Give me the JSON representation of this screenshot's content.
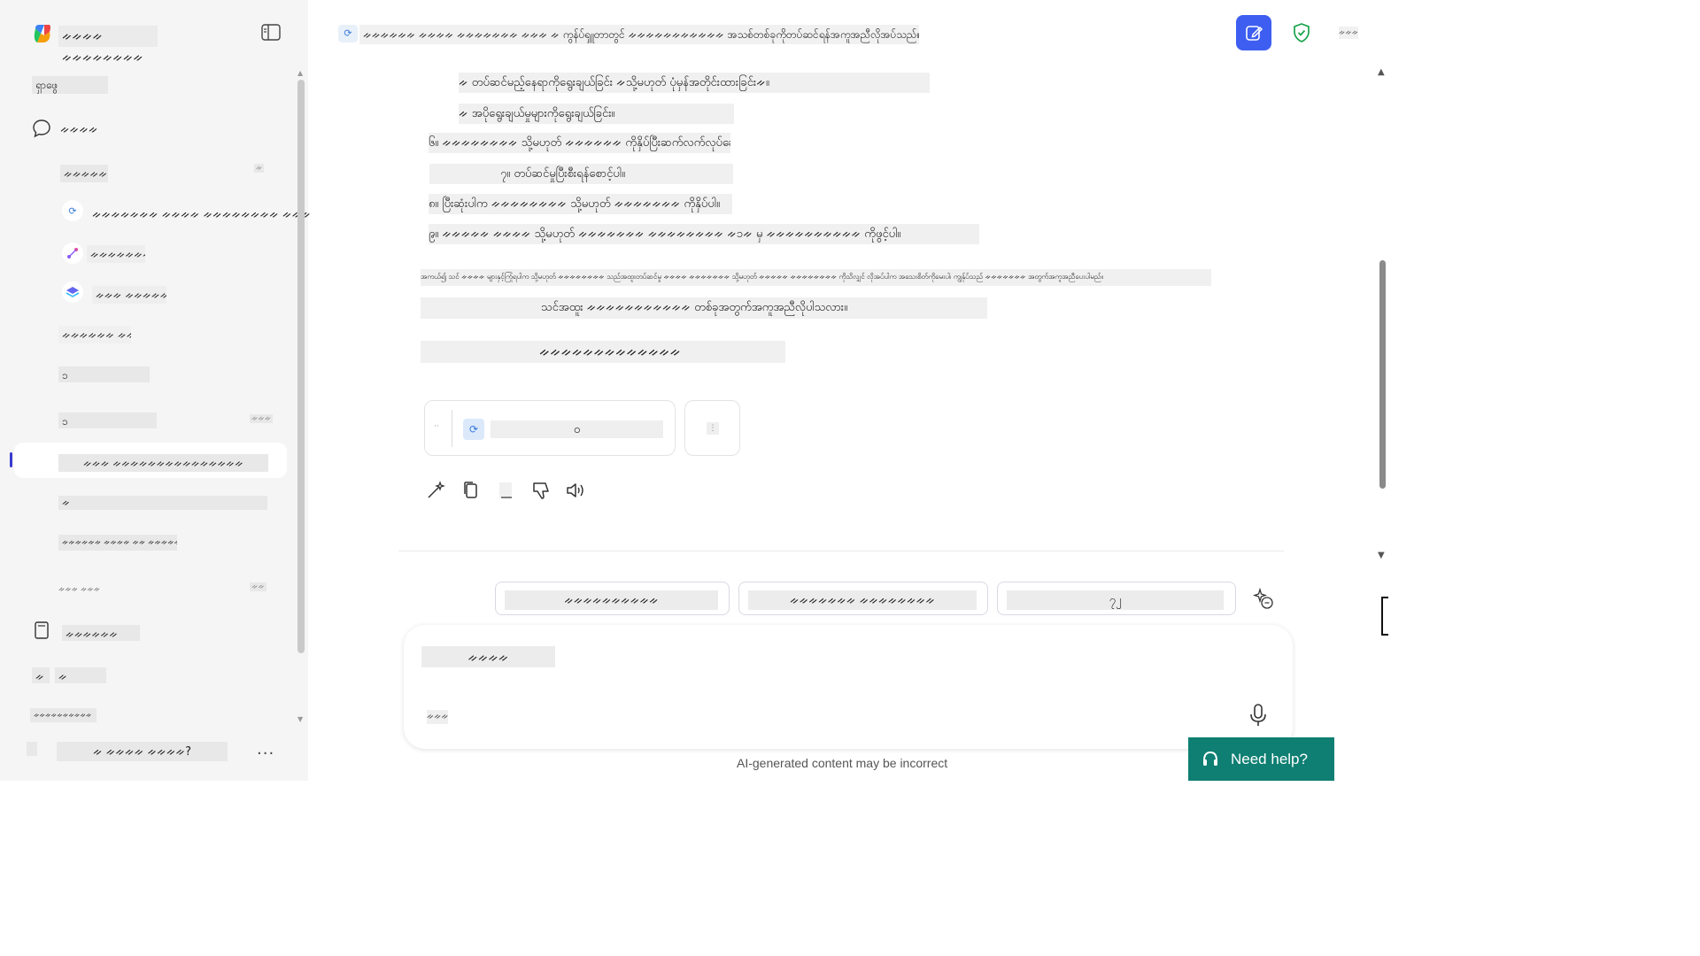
{
  "app": {
    "title": "ᨀᨀᨀᨀ ᨀᨀᨀᨀᨀᨀᨀᨀ"
  },
  "sidebar": {
    "discover": "ရှာဖွေ",
    "chats": "ᨀᨀᨀᨀ",
    "recent_header": "ᨀᨀᨀᨀᨀᨀ",
    "recent_badge": "ᨀ",
    "items": [
      {
        "label": "ᨀᨀᨀᨀᨀᨀᨀ ᨀᨀᨀᨀ ᨀᨀᨀᨀᨀᨀᨀᨀ ᨀᨀᨀ"
      },
      {
        "label": "ᨀᨀᨀᨀᨀᨀᨀ"
      },
      {
        "label": "ᨀᨀᨀ ᨀᨀᨀᨀᨀᨀ"
      }
    ],
    "section2": "ᨀᨀᨀᨀᨀᨀ ᨀᨀᨀᨀᨀ",
    "item_a": "၁",
    "item_b": "၁",
    "item_b_badge": "ᨀᨀᨀ",
    "active": "ᨀᨀᨀ ᨀᨀᨀᨀᨀᨀᨀᨀᨀᨀᨀᨀᨀᨀᨀ",
    "item_c": "ᨀ",
    "item_d": "ᨀᨀᨀᨀᨀᨀ ᨀᨀᨀᨀ ᨀᨀ ᨀᨀᨀᨀᨀᨀ",
    "item_e": "ᨀᨀᨀ ᨀᨀᨀ",
    "item_e_badge": "ᨀᨀ",
    "notebook": "ᨀᨀᨀᨀᨀᨀ",
    "item_f_icon": "ᨀ",
    "item_f": "ᨀ",
    "item_g": "ᨀᨀᨀᨀᨀᨀᨀᨀᨀᨀ",
    "footer_question": "ᨀ ᨀᨀᨀᨀ ᨀᨀᨀᨀ?",
    "more": "..."
  },
  "header": {
    "title": "ᨀᨀᨀᨀᨀᨀ ᨀᨀᨀᨀ ᨀᨀᨀᨀᨀᨀᨀ ᨀᨀᨀ ᨀ ကွန်ပ်ၡူတာတွင် ᨀᨀᨀᨀᨀᨀᨀᨀᨀᨀᨀ အသစ်တစ်ခုကိုတပ်ဆင်ရန်အကူအညီလိုအပ်သည်။",
    "more": "ᨀᨀᨀ"
  },
  "message": {
    "lines": [
      "ᨀ တပ်ဆင်မည့်နေရာကိုရွေးချယ်ခြင်း ᨀသို့မဟုတ် ပုံမှန်အတိုင်းထားခြင်းᨀ။",
      "ᨀ အပိုရွေးချယ်မှုများကိုရွေးချယ်ခြင်း။",
      "၆။ ᨀᨀᨀᨀᨀᨀᨀᨀ သို့မဟုတ် ᨀᨀᨀᨀᨀᨀ ကိုနှိပ်ပြီးဆက်လက်လုပ်ဆောင်ပါ။",
      "၇။ တပ်ဆင်မှုပြီးစီးရန်စောင့်ပါ။",
      "၈။ ပြီးဆုံးပါက ᨀᨀᨀᨀᨀᨀᨀᨀ သို့မဟုတ် ᨀᨀᨀᨀᨀᨀᨀ ကိုနှိပ်ပါ။",
      "၉။ ᨀᨀᨀᨀᨀ ᨀᨀᨀᨀ သို့မဟုတ် ᨀᨀᨀᨀᨀᨀᨀ ᨀᨀᨀᨀᨀᨀᨀᨀ ᨀ၁ᨀ မှ ᨀᨀᨀᨀᨀᨀᨀᨀᨀᨀ ကိုဖွင့်ပါ။"
    ],
    "note": "အကယ်၍ သင် ᨀᨀᨀᨀ များနှင့်ကြုံရပါက သို့မဟုတ် ᨀᨀᨀᨀᨀᨀᨀᨀ သည်အထူးတပ်ဆင်မှု ᨀᨀᨀᨀ ᨀᨀᨀᨀᨀᨀᨀ သို့မဟုတ် ᨀᨀᨀᨀᨀ ᨀᨀᨀᨀᨀᨀᨀᨀ ကိုသိလျှင် လိုအပ်ပါက အသေးစိတ်ကိုမေးပါ၊ ကျွန်ုပ်သည် ᨀᨀᨀᨀᨀᨀᨀ အတွက်အကူအညီပေးပါမည်။",
    "question": "သင်အထူး ᨀᨀᨀᨀᨀᨀᨀᨀᨀᨀᨀ တစ်ခုအတွက်အကူအညီလိုပါသလား။",
    "heading": "ᨀᨀᨀᨀᨀᨀᨀᨀᨀᨀᨀᨀᨀ"
  },
  "card": {
    "dots": "··",
    "label": "ဝ",
    "side": "⋮"
  },
  "suggestions": [
    "ᨀᨀᨀᨀᨀᨀᨀᨀᨀᨀ",
    "ᨀᨀᨀᨀᨀᨀᨀ ᨀᨀᨀᨀᨀᨀᨀᨀ",
    "၇၂"
  ],
  "composer": {
    "placeholder": "ᨀᨀᨀᨀ",
    "tool": "ᨀᨀᨀ"
  },
  "disclaimer": "AI-generated content may be incorrect",
  "help": {
    "label": "Need help?"
  },
  "colors": {
    "accent": "#3d5ef0",
    "help": "#0e7f72",
    "shield": "#16a34a"
  }
}
